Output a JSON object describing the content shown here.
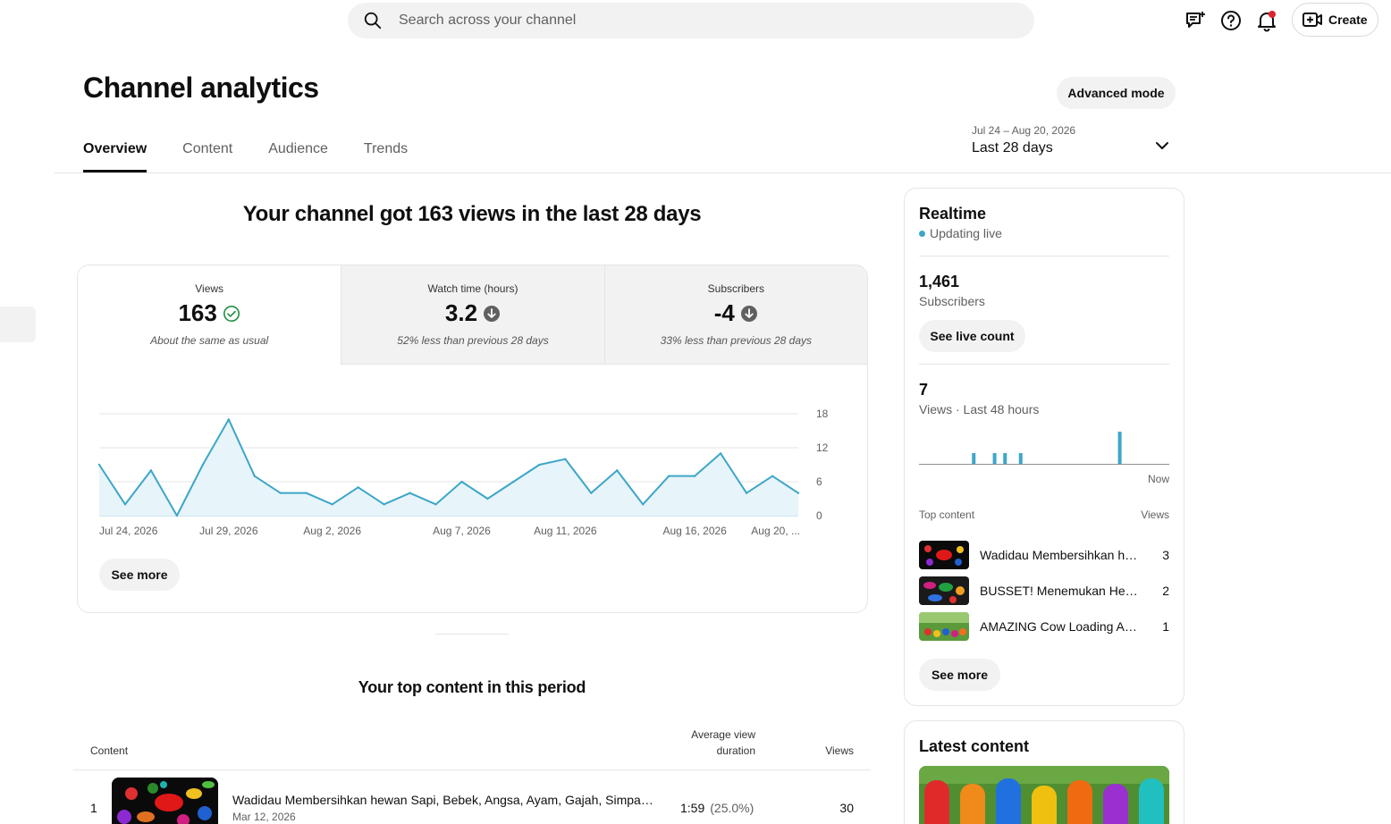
{
  "search": {
    "placeholder": "Search across your channel"
  },
  "topbar": {
    "icons": [
      "feedback-icon",
      "help-icon",
      "notifications-icon"
    ],
    "create_label": "Create"
  },
  "header": {
    "title": "Channel analytics",
    "advanced_mode_label": "Advanced mode",
    "tabs": [
      {
        "label": "Overview",
        "active": true
      },
      {
        "label": "Content"
      },
      {
        "label": "Audience"
      },
      {
        "label": "Trends"
      }
    ],
    "date_range": {
      "dates": "Jul 24 – Aug 20, 2026",
      "label": "Last 28 days"
    }
  },
  "overview": {
    "headline": "Your channel got 163 views in the last 28 days",
    "metrics": [
      {
        "label": "Views",
        "value": "163",
        "status": "same",
        "note": "About the same as usual"
      },
      {
        "label": "Watch time (hours)",
        "value": "3.2",
        "status": "down",
        "note": "52% less than previous 28 days"
      },
      {
        "label": "Subscribers",
        "value": "-4",
        "status": "down",
        "note": "33% less than previous 28 days"
      }
    ],
    "see_more_label": "See more"
  },
  "chart_data": {
    "type": "area",
    "x": [
      "Jul 24, 2026",
      "Jul 25, 2026",
      "Jul 26, 2026",
      "Jul 27, 2026",
      "Jul 28, 2026",
      "Jul 29, 2026",
      "Jul 30, 2026",
      "Jul 31, 2026",
      "Aug 1, 2026",
      "Aug 2, 2026",
      "Aug 3, 2026",
      "Aug 4, 2026",
      "Aug 5, 2026",
      "Aug 6, 2026",
      "Aug 7, 2026",
      "Aug 8, 2026",
      "Aug 9, 2026",
      "Aug 10, 2026",
      "Aug 11, 2026",
      "Aug 12, 2026",
      "Aug 13, 2026",
      "Aug 14, 2026",
      "Aug 15, 2026",
      "Aug 16, 2026",
      "Aug 17, 2026",
      "Aug 18, 2026",
      "Aug 19, 2026",
      "Aug 20, 2026"
    ],
    "series": [
      {
        "values": [
          9,
          2,
          8,
          0,
          9,
          17,
          7,
          4,
          4,
          2,
          5,
          2,
          4,
          2,
          6,
          3,
          6,
          9,
          10,
          4,
          8,
          2,
          7,
          7,
          11,
          4,
          7,
          4
        ]
      }
    ],
    "xtick_labels": [
      "Jul 24, 2026",
      "Jul 29, 2026",
      "Aug 2, 2026",
      "Aug 7, 2026",
      "Aug 11, 2026",
      "Aug 16, 2026",
      "Aug 20, ..."
    ],
    "ytick_labels": [
      "0",
      "6",
      "12",
      "18"
    ],
    "ylim": [
      0,
      18
    ],
    "grid": true,
    "color": "#3ea6c8",
    "fill": "#e7f4f9"
  },
  "top_content": {
    "title": "Your top content in this period",
    "headers": {
      "content": "Content",
      "avd_line1": "Average view",
      "avd_line2": "duration",
      "views": "Views"
    },
    "rows": [
      {
        "rank": "1",
        "title": "Wadidau Membersihkan hewan Sapi, Bebek, Angsa, Ayam, Gajah, Simpanse, ...",
        "date": "Mar 12, 2026",
        "duration": "1:59",
        "percent": "(25.0%)",
        "views": "30"
      }
    ]
  },
  "realtime": {
    "title": "Realtime",
    "status": "Updating live",
    "subscribers_value": "1,461",
    "subscribers_label": "Subscribers",
    "live_count_label": "See live count",
    "views_value": "7",
    "views_label": "Views · Last 48 hours",
    "now_label": "Now",
    "bars": [
      0,
      0,
      0,
      0,
      0,
      0,
      0,
      0,
      0,
      0,
      1,
      0,
      0,
      0,
      1,
      0,
      1,
      0,
      0,
      1,
      0,
      0,
      0,
      0,
      0,
      0,
      0,
      0,
      0,
      0,
      0,
      0,
      0,
      0,
      0,
      0,
      0,
      0,
      3,
      0,
      0,
      0,
      0,
      0,
      0,
      0,
      0,
      0
    ],
    "top_content_label": "Top content",
    "views_col_label": "Views",
    "items": [
      {
        "title": "Wadidau Membersihkan hewan Sapi...",
        "views": "3"
      },
      {
        "title": "BUSSET! Menemukan Hewan...",
        "views": "2"
      },
      {
        "title": "AMAZING Cow Loading Activity...",
        "views": "1"
      }
    ],
    "see_more_label": "See more"
  },
  "latest": {
    "title": "Latest content"
  }
}
